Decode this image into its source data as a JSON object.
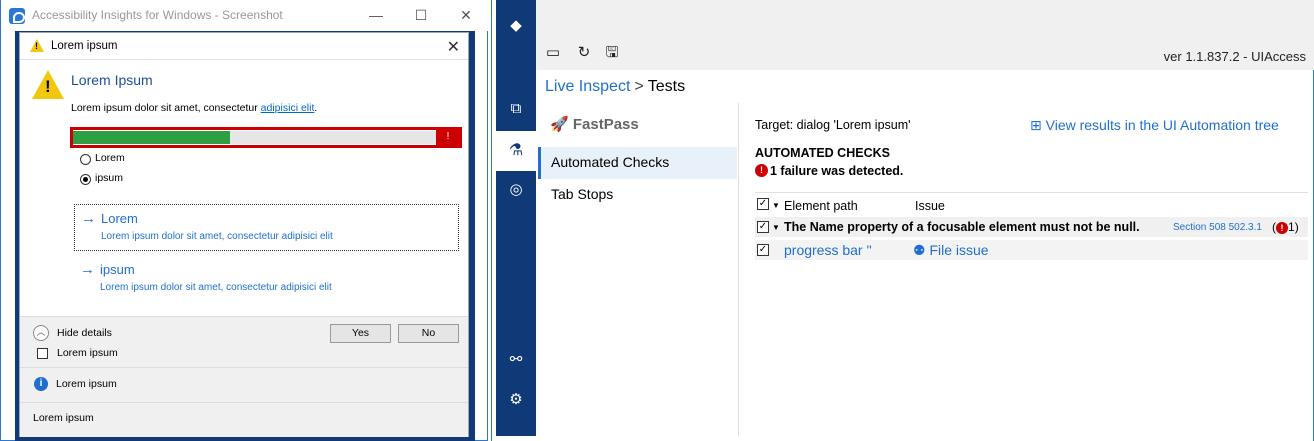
{
  "viewer": {
    "title": "Accessibility Insights for Windows - Screenshot",
    "minimize": "—",
    "maximize": "☐",
    "close": "✕",
    "dialog": {
      "title": "Lorem ipsum",
      "heading": "Lorem Ipsum",
      "text": "Lorem ipsum dolor sit amet, consectetur",
      "link": "adipisici elit",
      "link_suffix": ".",
      "progress": 0.43,
      "progress_error": "!",
      "radio1": "Lorem",
      "radio2": "ipsum",
      "radio_selected": "ipsum",
      "cmd1_title": "Lorem",
      "cmd1_sub": "Lorem ipsum dolor sit amet, consectetur adipisici elit",
      "cmd2_title": "ipsum",
      "cmd2_sub": "Lorem ipsum dolor sit amet, consectetur adipisici elit",
      "hide_details": "Hide details",
      "yes": "Yes",
      "no": "No",
      "checkbox": "Lorem ipsum",
      "info": "Lorem ipsum",
      "footer": "Lorem ipsum"
    }
  },
  "app": {
    "version": "ver 1.1.837.2 - UIAccess",
    "breadcrumb_link": "Live Inspect",
    "breadcrumb_sep": ">",
    "breadcrumb_current": "Tests",
    "sidebar": {
      "fastpass": "FastPass",
      "items": [
        {
          "label": "Automated Checks",
          "selected": true
        },
        {
          "label": "Tab Stops",
          "selected": false
        }
      ]
    },
    "content": {
      "target": "Target: dialog 'Lorem ipsum'",
      "view_tree": "View results in the UI Automation tree",
      "heading": "AUTOMATED CHECKS",
      "failure_summary": "1 failure was detected.",
      "col_element_path": "Element path",
      "col_issue": "Issue",
      "rule_text": "The Name property of a focusable element must not be null.",
      "rule_link": "Section 508 502.3.1",
      "rule_count": "1",
      "element": "progress bar ''",
      "file_issue": "File issue"
    }
  },
  "colors": {
    "brand_dark": "#0f3a77",
    "link": "#1f6fd0",
    "error": "#cc0000",
    "progress": "#2ea043"
  }
}
